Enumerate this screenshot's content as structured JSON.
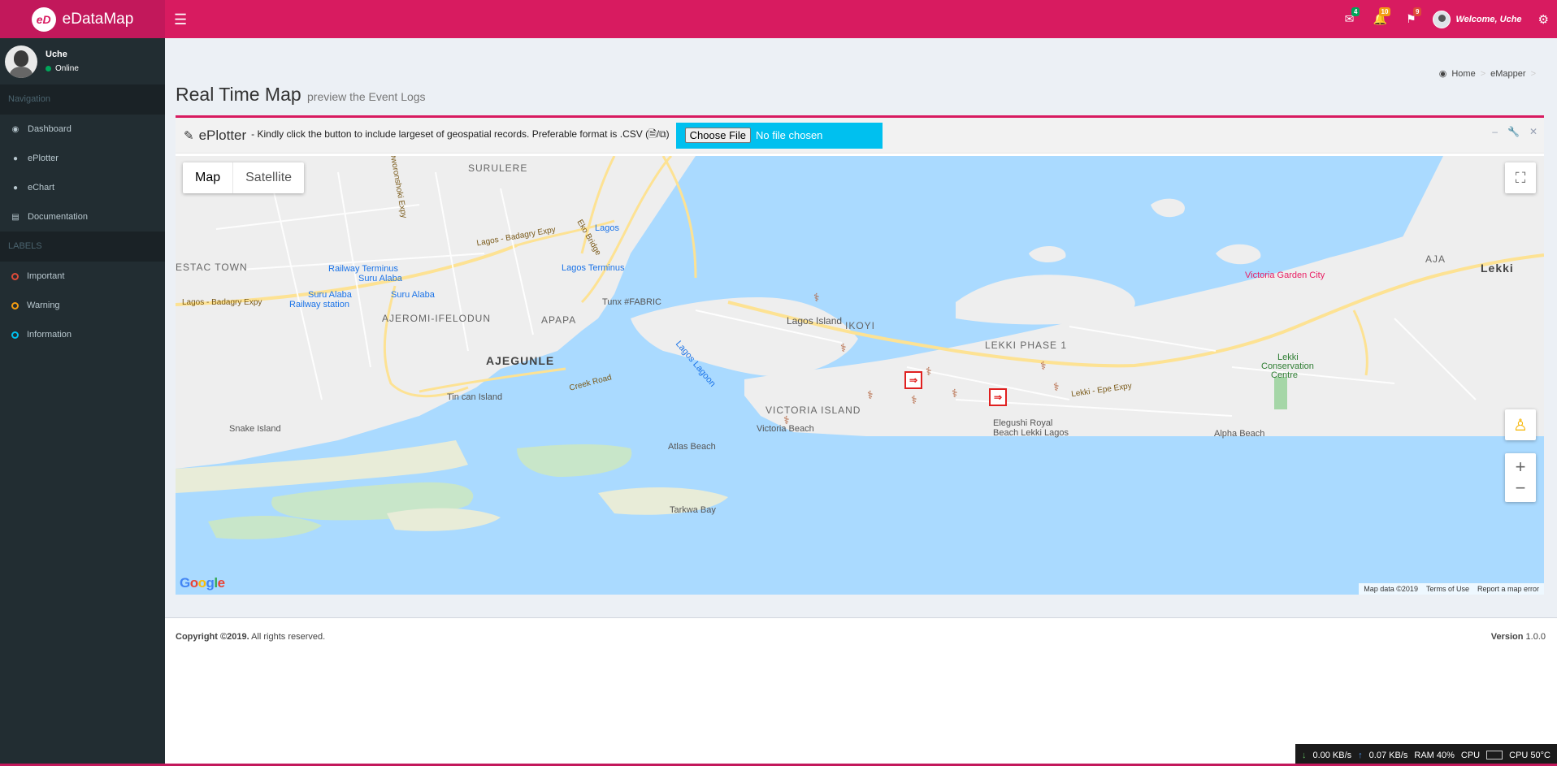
{
  "brand": {
    "logo_letters": "eD",
    "name": "eDataMap"
  },
  "topbar": {
    "mail_count": "4",
    "bell_count": "10",
    "flag_count": "9",
    "welcome": "Welcome, Uche",
    "colors": {
      "bar": "#d81b60",
      "mail_badge": "#00a65a",
      "bell_badge": "#f39c12",
      "flag_badge": "#dd4b39"
    }
  },
  "sidebar": {
    "user": {
      "name": "Uche",
      "status": "Online"
    },
    "nav_header": "Navigation",
    "items": [
      {
        "label": "Dashboard",
        "icon": "dashboard-icon"
      },
      {
        "label": "ePlotter",
        "icon": "map-marker-icon"
      },
      {
        "label": "eChart",
        "icon": "map-marker-icon"
      },
      {
        "label": "Documentation",
        "icon": "book-icon"
      }
    ],
    "labels_header": "LABELS",
    "labels": [
      {
        "label": "Important",
        "color": "#dd4b39"
      },
      {
        "label": "Warning",
        "color": "#f39c12"
      },
      {
        "label": "Information",
        "color": "#00c0ef"
      }
    ]
  },
  "header": {
    "title": "Real Time Map",
    "subtitle": "preview the Event Logs",
    "breadcrumb": [
      "Home",
      "eMapper"
    ]
  },
  "box": {
    "title": "ePlotter",
    "note": "- Kindly click the button to include largeset of geospatial records. Preferable format is .CSV (",
    "note_end": ")",
    "file_button": "Choose File",
    "file_status": "No file chosen"
  },
  "map": {
    "type_map": "Map",
    "type_satellite": "Satellite",
    "labels": {
      "surulere": "SURULERE",
      "estac_town": "ESTAC TOWN",
      "railway_terminus": "Railway Terminus",
      "suru_alaba": "Suru Alaba",
      "suru_alaba_station": "Suru Alaba",
      "railway_station": "Railway station",
      "suru_alaba2": "Suru Alaba",
      "ajeromi": "AJEROMI-IFELODUN",
      "apapa": "APAPA",
      "ajegunle": "AJEGUNLE",
      "tin_can": "Tin can Island",
      "snake_island": "Snake Island",
      "atlas_beach": "Atlas Beach",
      "tarkwa_bay": "Tarkwa Bay",
      "lagos": "Lagos",
      "lagos_terminus": "Lagos Terminus",
      "tunx": "Tunx #FABRIC",
      "lagos_lagoon": "Lagos Lagoon",
      "lagos_island": "Lagos Island",
      "ikoyi": "IKOYI",
      "victoria_island": "VICTORIA ISLAND",
      "victoria_beach": "Victoria Beach",
      "lekki_phase1": "LEKKI PHASE 1",
      "elegushi": "Elegushi Royal",
      "elegushi2": "Beach Lekki Lagos",
      "lekki_conservation": "Lekki",
      "lekki_conservation2": "Conservation",
      "lekki_conservation3": "Centre",
      "alpha_beach": "Alpha Beach",
      "victoria_garden": "Victoria Garden City",
      "aja": "AJA",
      "lekki": "Lekki",
      "lagos_badagry": "Lagos - Badagry Expy",
      "lagos_badagry2": "Lagos - Badagry Expy",
      "eko_bridge": "Eko Bridge",
      "creek_road": "Creek Road",
      "lekki_epe": "Lekki - Epe Expy",
      "oworonshoki": "Oworonshoki Expy"
    },
    "google": "Google",
    "attribution": [
      "Map data ©2019",
      "Terms of Use",
      "Report a map error"
    ]
  },
  "footer": {
    "copyright_bold": "Copyright ©2019.",
    "copyright_rest": "All rights reserved.",
    "version_label": "Version",
    "version": "1.0.0"
  },
  "sysbar": {
    "down": "0.00 KB/s",
    "up": "0.07 KB/s",
    "ram": "RAM 40%",
    "cpu": "CPU",
    "cpu_temp": "CPU 50°C"
  }
}
